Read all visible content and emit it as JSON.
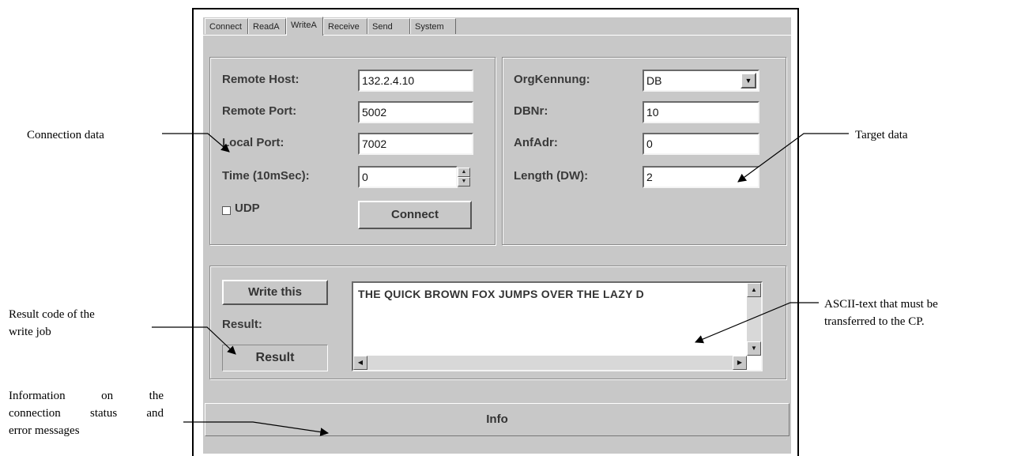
{
  "tabs": [
    {
      "label": "Connect",
      "underline": "C",
      "active": false
    },
    {
      "label": "ReadA",
      "active": false
    },
    {
      "label": "WriteA",
      "active": true
    },
    {
      "label": "Receive",
      "active": false
    },
    {
      "label": "Send",
      "active": false
    },
    {
      "label": "System",
      "active": false
    }
  ],
  "connection": {
    "remote_host_label": "Remote Host:",
    "remote_host_value": "132.2.4.10",
    "remote_port_label": "Remote Port:",
    "remote_port_value": "5002",
    "local_port_label": "Local Port:",
    "local_port_value": "7002",
    "time_label": "Time (10mSec):",
    "time_value": "0",
    "udp_label": "UDP",
    "udp_checked": false,
    "connect_button": "Connect"
  },
  "target": {
    "org_label": "OrgKennung:",
    "org_value": "DB",
    "dbnr_label": "DBNr:",
    "dbnr_value": "10",
    "anfadr_label": "AnfAdr:",
    "anfadr_value": "0",
    "length_label": "Length (DW):",
    "length_value": "2"
  },
  "write": {
    "write_button": "Write this",
    "result_label": "Result:",
    "result_value": "Result",
    "text": "THE QUICK BROWN FOX JUMPS OVER THE LAZY D"
  },
  "info": "Info",
  "annotations": {
    "connection_data": "Connection data",
    "target_data": "Target data",
    "ascii_text_line1": "ASCII-text that must be",
    "ascii_text_line2": "transferred to the CP.",
    "result_code_line1": "Result code of the",
    "result_code_line2": "write job",
    "info_line1": "Information on the",
    "info_line2": "connection status and",
    "info_line3": "error messages"
  }
}
